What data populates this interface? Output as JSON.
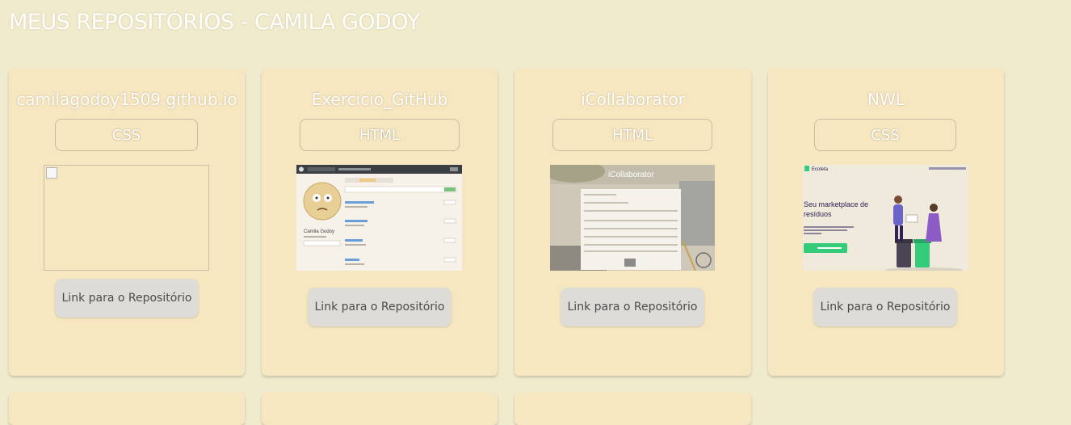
{
  "page": {
    "title": "MEUS REPOSITÓRIOS - CAMILA GODOY"
  },
  "repos": [
    {
      "name": "camilagodoy1509.github.io",
      "language": "CSS",
      "link_label": "Link para o Repositório",
      "thumbnail": "broken-image"
    },
    {
      "name": "Exercicio_GitHub",
      "language": "HTML",
      "link_label": "Link para o Repositório",
      "thumbnail": "github-profile-screenshot",
      "thumb_text": {
        "profile_name": "Camila Godoy"
      }
    },
    {
      "name": "iCollaborator",
      "language": "HTML",
      "link_label": "Link para o Repositório",
      "thumbnail": "icollaborator-screenshot",
      "thumb_text": {
        "brand": "iCollaborator"
      }
    },
    {
      "name": "NWL",
      "language": "CSS",
      "link_label": "Link para o Repositório",
      "thumbnail": "ecoleta-screenshot",
      "thumb_text": {
        "brand": "Ecoleta",
        "headline": "Seu marketplace de resíduos"
      }
    }
  ],
  "colors": {
    "background": "#f1ebcd",
    "card": "#f7e7c1",
    "button": "#dedcd6",
    "ecoleta_green": "#34cb79"
  }
}
